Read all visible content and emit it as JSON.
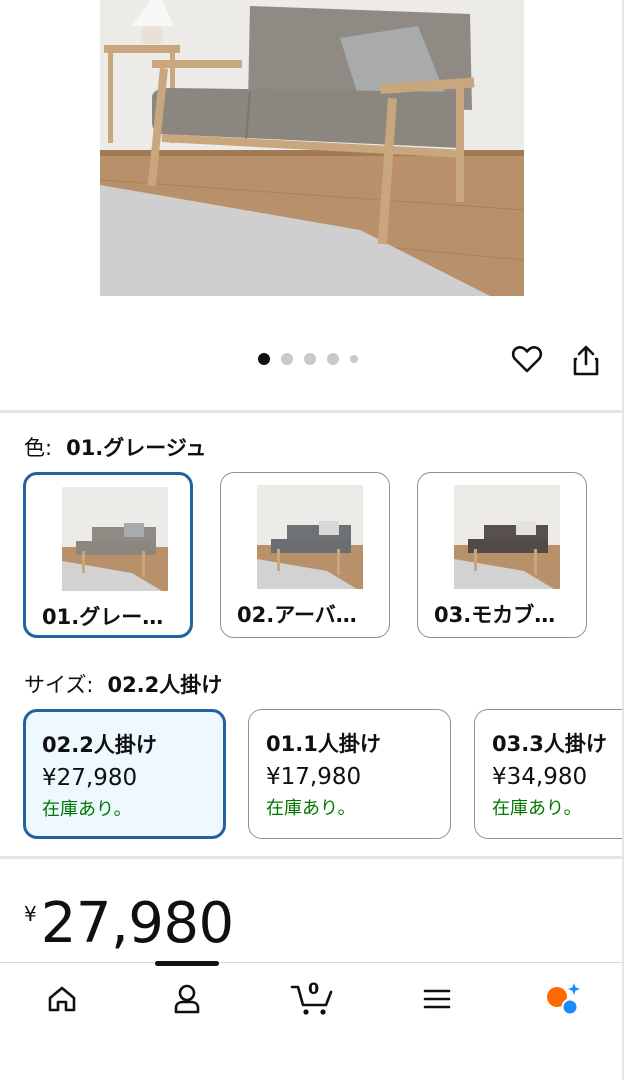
{
  "colors": {
    "accent": "#2162a1",
    "stock_green": "#007600",
    "selected_bg": "#edf8ff",
    "ai_orange": "#ff6a00",
    "ai_blue": "#1a8cff"
  },
  "product_image": {
    "icon": "sofa-photo",
    "carousel": {
      "count": 5,
      "active_index": 0
    }
  },
  "actions": {
    "favorite_icon": "heart-icon",
    "share_icon": "share-icon"
  },
  "color_selector": {
    "label": "色:",
    "selected": "01.グレージュ",
    "options": [
      {
        "name": "01.グレー…",
        "fabric": "#8f8a84",
        "selected": true
      },
      {
        "name": "02.アーバ…",
        "fabric": "#6f7275",
        "selected": false
      },
      {
        "name": "03.モカブ…",
        "fabric": "#57504c",
        "selected": false
      }
    ]
  },
  "size_selector": {
    "label": "サイズ:",
    "selected": "02.2人掛け",
    "options": [
      {
        "name": "02.2人掛け",
        "price": "¥27,980",
        "stock": "在庫あり。",
        "selected": true
      },
      {
        "name": "01.1人掛け",
        "price": "¥17,980",
        "stock": "在庫あり。",
        "selected": false
      },
      {
        "name": "03.3人掛け",
        "price": "¥34,980",
        "stock": "在庫あり。",
        "selected": false
      }
    ]
  },
  "price": {
    "symbol": "¥",
    "amount": "27,980"
  },
  "bottom_nav": {
    "items": [
      {
        "icon": "home-icon"
      },
      {
        "icon": "account-icon",
        "active": true
      },
      {
        "icon": "cart-icon",
        "count": "0"
      },
      {
        "icon": "menu-icon"
      },
      {
        "icon": "ai-assistant-icon"
      }
    ]
  }
}
